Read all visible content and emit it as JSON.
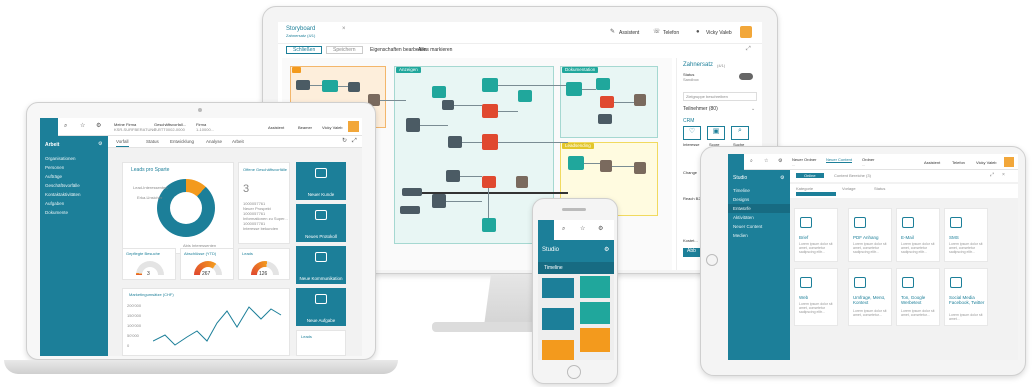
{
  "monitor": {
    "title": "Storyboard",
    "subtitle": "Zahnersatz (4/1)",
    "top_actions": [
      "Assistent",
      "Telefon",
      "Vicky Valeb"
    ],
    "toolbar": [
      "Schließen",
      "Speichern",
      "Eigenschaften bearbeiten",
      "Alles markieren"
    ],
    "groups": [
      "Anzeigen",
      "Dokumentation",
      "Leadstudie",
      "Leadsending"
    ],
    "right_panel": {
      "title": "Zahnersatz",
      "title_badge": "(4/1)",
      "status_label": "Status",
      "status_value": "Sandbox",
      "description_placeholder": "Zielgruppe beschreiben",
      "participants": "Teilnehmer (80)",
      "crm": "CRM",
      "crm_items": [
        "Interesse",
        "Score",
        "Suche"
      ],
      "change": "Change",
      "reach": "Reach B2",
      "kostet": "Kostet...",
      "button": "Abb"
    }
  },
  "laptop": {
    "search_icon": "search-icon",
    "topbar_companies": [
      {
        "name": "Meine Firma",
        "sub": "KSR-SURFBERATUNG..."
      },
      {
        "name": "Geschäftsvorfall...",
        "sub": "P-RTT0002-0000"
      },
      {
        "name": "Firma",
        "sub": "1-10000..."
      }
    ],
    "top_actions": [
      "Assistent",
      "Beamer",
      "Vicky Valeb"
    ],
    "sidebar_title": "Arbeit",
    "sidebar_items": [
      "Organisationen",
      "Personen",
      "Aufträge",
      "Geschäftsvorfälle",
      "Kontaktaktivitäten",
      "Aufgaben",
      "Dokumente"
    ],
    "tabs": [
      "Vorfall",
      "Status",
      "Entwicklung",
      "Analyse",
      "Arbeit"
    ],
    "lead_card": {
      "title": "Leads pro Sparte",
      "labels": [
        "Lead-Interessenten",
        "Erka-Unsicher",
        "Abis Interessenten"
      ]
    },
    "offers": {
      "title": "Offene Geschäftsvorfälle",
      "count": "3",
      "rows": [
        "1000057761",
        "Neuer Prospekt",
        "1000057761",
        "Informationen zu Super...",
        "1000057781",
        "Interesse bekunden"
      ]
    },
    "tiles": [
      "Neuer Kunde",
      "Neues Protokoll",
      "Neue Kommunikation",
      "Neue Aufgabe"
    ],
    "gauges": [
      {
        "title": "Gepflegte Besuche",
        "value": "3"
      },
      {
        "title": "Abschlüsse (YTD)",
        "value": "267"
      },
      {
        "title": "Leads",
        "value": "126"
      }
    ],
    "gauge_levels": [
      0.05,
      0.7,
      0.55
    ],
    "chart": {
      "title": "Marketingumsätze (CHF)",
      "yticks": [
        "200'000",
        "150'000",
        "100'000",
        "50'000",
        "0"
      ]
    },
    "leads_label": "Leads"
  },
  "phone": {
    "app_title": "Studio",
    "timeline": "Timeline"
  },
  "tablet": {
    "sidebar_title": "Studio",
    "sidebar_items": [
      "Timeline",
      "Designs",
      "Entwürfe",
      "Aktivitäten",
      "Neuer Content",
      "Medien"
    ],
    "header": [
      {
        "name": "Neuer Ordner",
        "sub": "..."
      },
      {
        "name": "Neuer Content",
        "sub": ""
      },
      {
        "name": "Ordner",
        "sub": "..."
      }
    ],
    "top_actions": [
      "Assistent",
      "Telefon",
      "Vicky Valeb"
    ],
    "subtabs": [
      "Online",
      "Content Bereiche (3)"
    ],
    "fields": [
      "Kategorie",
      "Vorlage",
      "Status"
    ],
    "cards": [
      {
        "title": "Brief",
        "text": "Lorem ipsum dolor sit amet, consetetur sadipscing elitr..."
      },
      {
        "title": "PDF Anhang",
        "text": "Lorem ipsum dolor sit amet, consetetur sadipscing elitr..."
      },
      {
        "title": "E-Mail",
        "text": "Lorem ipsum dolor sit amet, consetetur sadipscing elitr..."
      },
      {
        "title": "SMS",
        "text": "Lorem ipsum dolor sit amet, consetetur sadipscing elitr..."
      },
      {
        "title": "Web",
        "text": "Lorem ipsum dolor sit amet, consetetur sadipscing elitr..."
      },
      {
        "title": "Umfrage, Menü, Kontext",
        "text": "Lorem ipsum dolor sit amet, consetetur..."
      },
      {
        "title": "Ton, Google Werbetext",
        "text": "Lorem ipsum dolor sit amet, consetetur..."
      },
      {
        "title": "Social Media Facebook, Twitter",
        "text": "Lorem ipsum dolor sit amet..."
      }
    ]
  },
  "colors": {
    "teal": "#1c7f99",
    "orange": "#f39a1d",
    "red": "#e0492f",
    "green": "#20a79c"
  }
}
